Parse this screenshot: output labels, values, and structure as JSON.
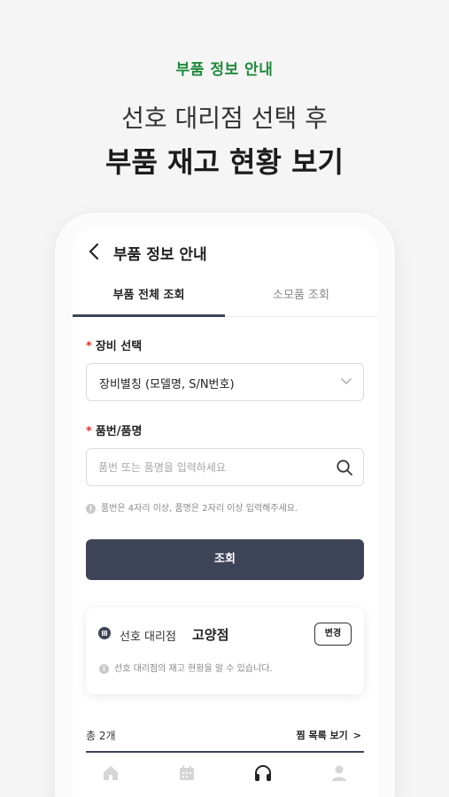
{
  "promo": {
    "subtitle": "부품 정보 안내",
    "headline_line1": "선호 대리점 선택 후",
    "headline_line2": "부품 재고 현황 보기"
  },
  "appbar": {
    "title": "부품 정보 안내"
  },
  "tabs": [
    {
      "label": "부품 전체 조회",
      "active": true
    },
    {
      "label": "소모품 조회",
      "active": false
    }
  ],
  "form": {
    "required_mark": "*",
    "equipment_label": "장비 선택",
    "equipment_value": "장비별칭 (모델명, S/N번호)",
    "part_label": "품번/품명",
    "part_placeholder": "품번 또는 품명을 입력하세요",
    "part_value": "",
    "hint": "품번은 4자리 이상, 품명은 2자리 이상 입력해주세요.",
    "search_button": "조회"
  },
  "store": {
    "label": "선호 대리점",
    "name": "고양점",
    "change_button": "변경",
    "note": "선호 대리점의 재고 현황을 알 수 있습니다."
  },
  "results": {
    "total": "총 2개",
    "wishlist_link": "찜 목록 보기",
    "wishlist_arrow": ">"
  },
  "info_glyph": "i",
  "bottom_nav": [
    {
      "icon": "home-icon",
      "active": false
    },
    {
      "icon": "calendar-icon",
      "active": false
    },
    {
      "icon": "headset-icon",
      "active": true
    },
    {
      "icon": "person-icon",
      "active": false
    }
  ],
  "colors": {
    "accent_green": "#1f8a3c",
    "primary_dark": "#3e4458",
    "required_red": "#e2332c"
  }
}
